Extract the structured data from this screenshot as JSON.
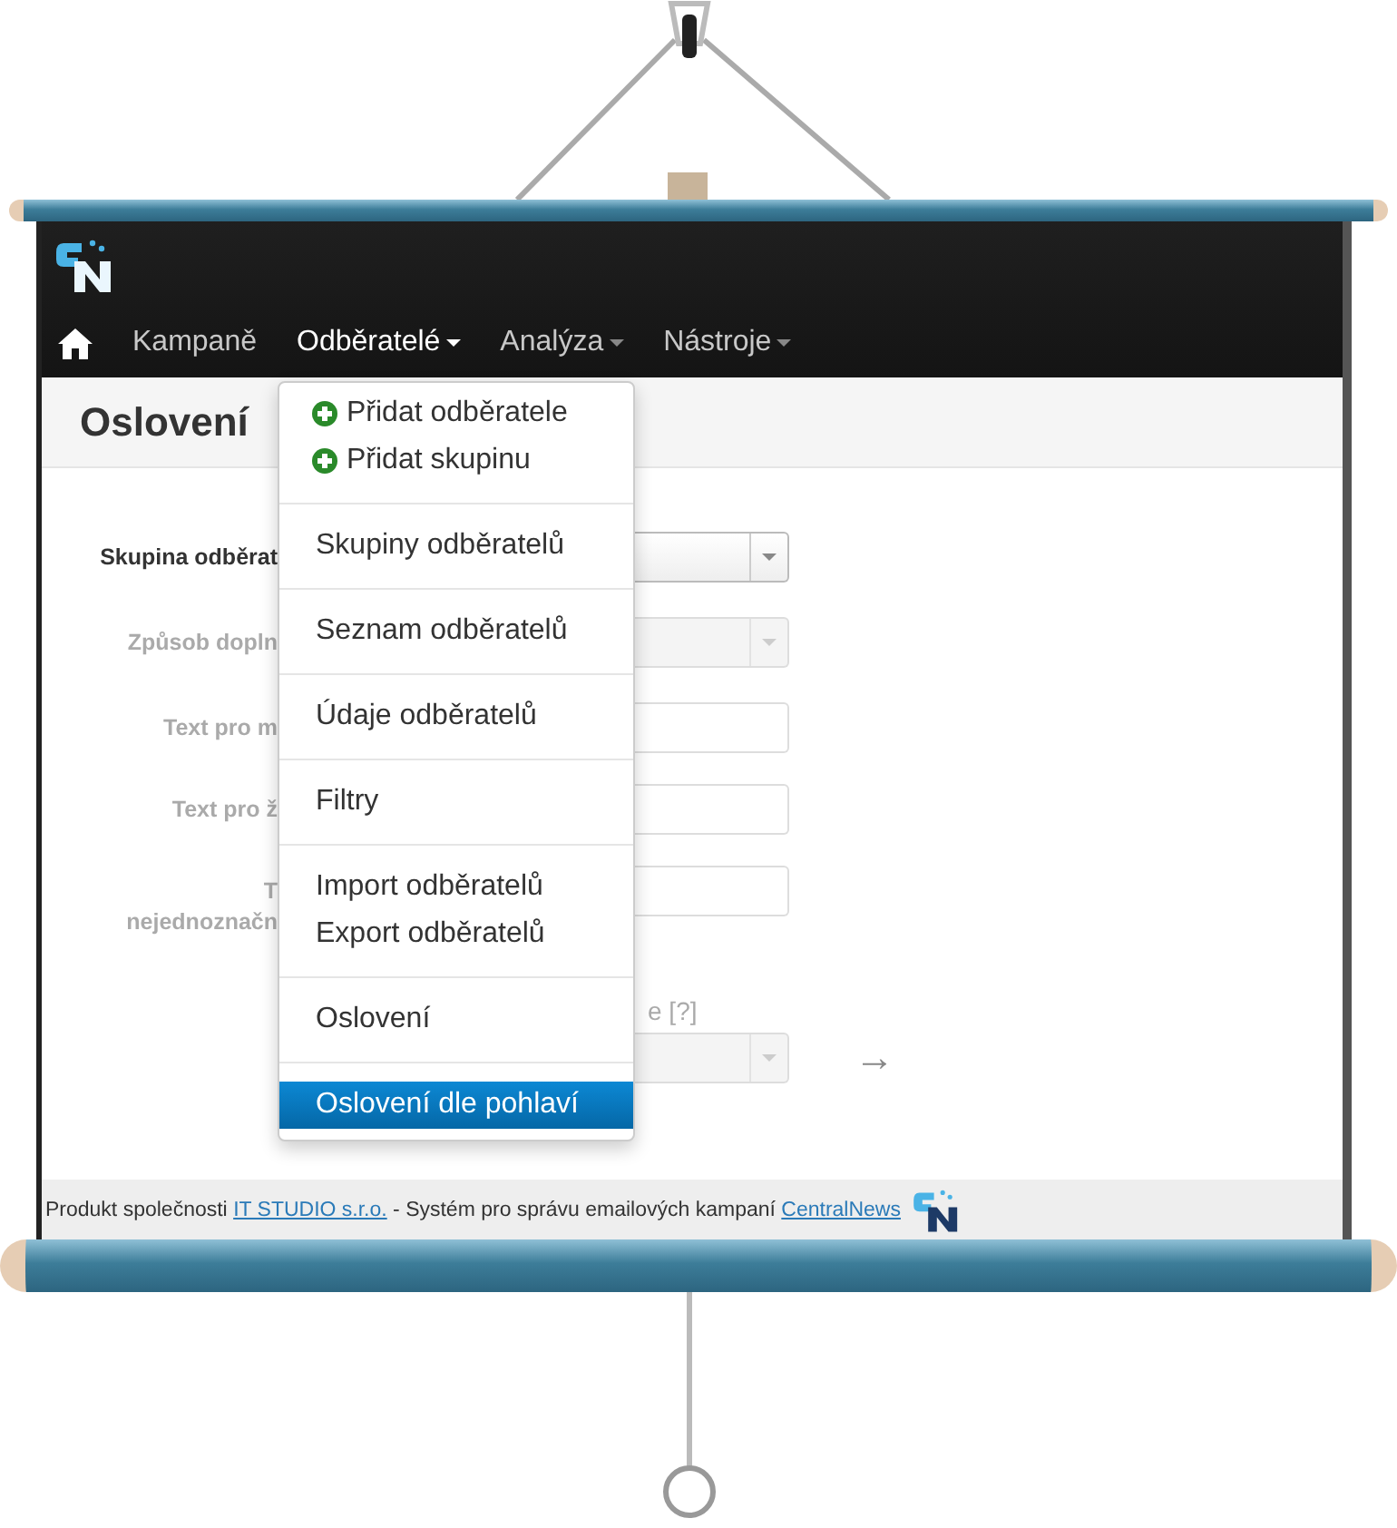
{
  "nav": [
    {
      "label": "Kampaně",
      "dropdown": false,
      "selected": false
    },
    {
      "label": "Odběratelé",
      "dropdown": true,
      "selected": true
    },
    {
      "label": "Analýza",
      "dropdown": true,
      "selected": false
    },
    {
      "label": "Nástroje",
      "dropdown": true,
      "selected": false
    }
  ],
  "page_title": "Oslovení",
  "form": [
    {
      "label": [
        "Skupina odběrat"
      ],
      "kind": "select",
      "disabled": false
    },
    {
      "label": [
        "Způsob dopln"
      ],
      "kind": "select",
      "disabled": true
    },
    {
      "label": [
        "Text pro m"
      ],
      "kind": "input",
      "disabled": true
    },
    {
      "label": [
        "Text pro ž"
      ],
      "kind": "input",
      "disabled": true
    },
    {
      "label": [
        "T",
        "nejednoznačn"
      ],
      "kind": "input",
      "disabled": true
    },
    {
      "top_label": "e [?]",
      "kind": "select",
      "disabled": true,
      "arrow": "→"
    }
  ],
  "menu": [
    {
      "kind": "add",
      "label": "Přidat odběratele",
      "selected": false
    },
    {
      "kind": "add",
      "label": "Přidat skupinu",
      "selected": false
    },
    {
      "kind": "divider"
    },
    {
      "kind": "link",
      "label": "Skupiny odběratelů",
      "selected": false
    },
    {
      "kind": "divider"
    },
    {
      "kind": "link",
      "label": "Seznam odběratelů",
      "selected": false
    },
    {
      "kind": "divider"
    },
    {
      "kind": "link",
      "label": "Údaje odběratelů",
      "selected": false
    },
    {
      "kind": "divider"
    },
    {
      "kind": "link",
      "label": "Filtry",
      "selected": false
    },
    {
      "kind": "divider"
    },
    {
      "kind": "link",
      "label": "Import odběratelů",
      "selected": false
    },
    {
      "kind": "link",
      "label": "Export odběratelů",
      "selected": false
    },
    {
      "kind": "divider"
    },
    {
      "kind": "link",
      "label": "Oslovení",
      "selected": false
    },
    {
      "kind": "divider"
    },
    {
      "kind": "link",
      "label": "Oslovení dle pohlaví",
      "selected": true
    }
  ],
  "footer": [
    {
      "kind": "text",
      "text": "Produkt společnosti "
    },
    {
      "kind": "link",
      "text": "IT STUDIO s.r.o."
    },
    {
      "kind": "text",
      "text": " - Systém pro správu emailových kampaní "
    },
    {
      "kind": "link",
      "text": "CentralNews"
    }
  ]
}
